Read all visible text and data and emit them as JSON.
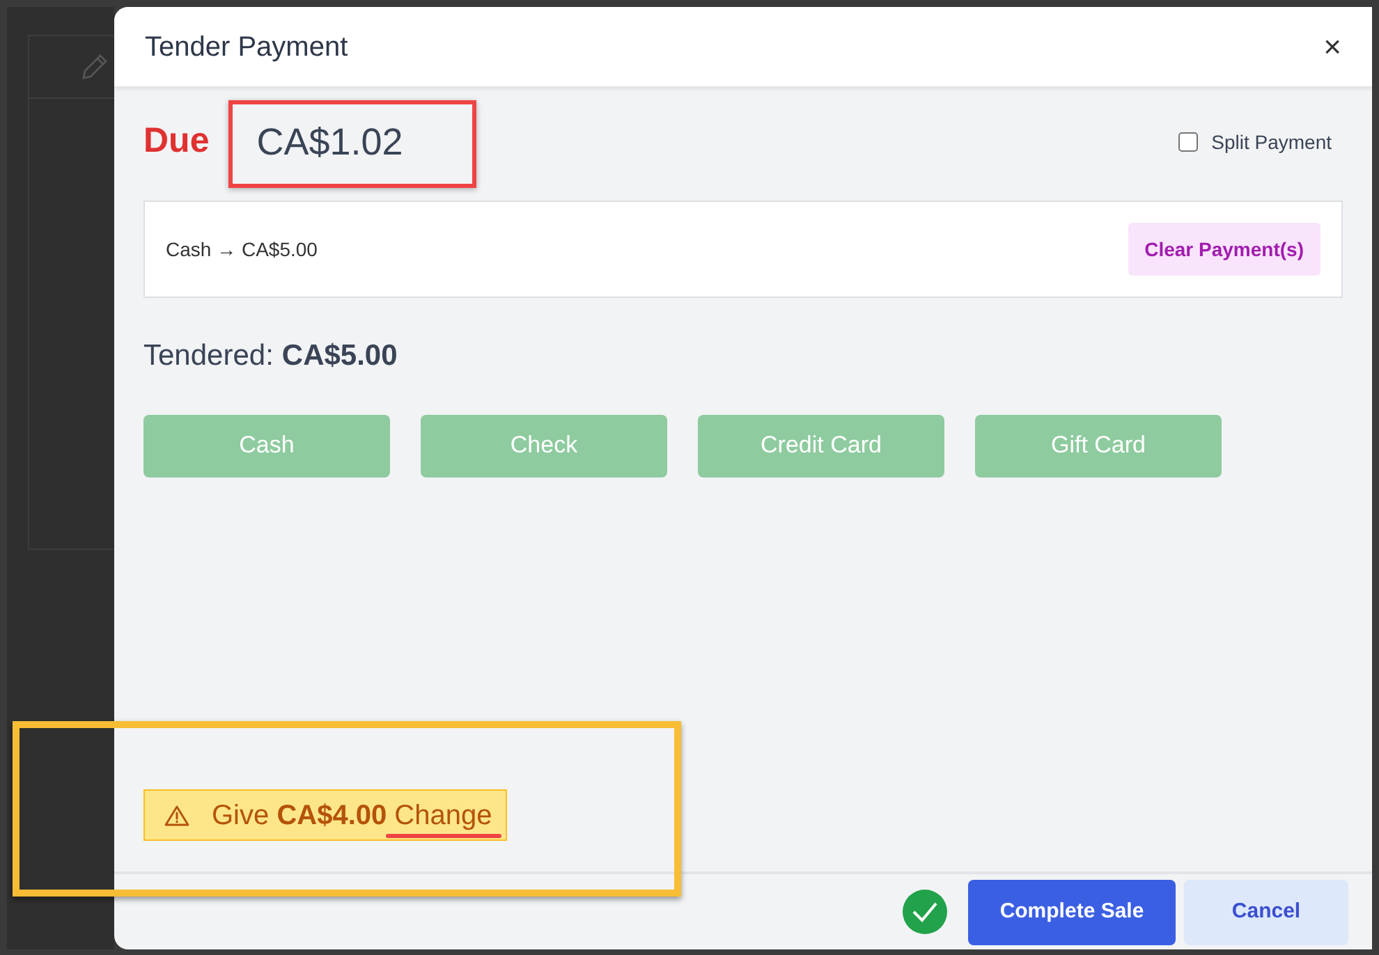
{
  "dialog": {
    "title": "Tender Payment",
    "close": "×"
  },
  "due": {
    "label": "Due",
    "amount": "CA$1.02"
  },
  "split_payment": {
    "label": "Split Payment",
    "checked": false
  },
  "payments": [
    {
      "text": "Cash → CA$5.00"
    }
  ],
  "clear_button": "Clear Payment(s)",
  "tendered": {
    "label": "Tendered:",
    "amount": "CA$5.00"
  },
  "methods": [
    "Cash",
    "Check",
    "Credit Card",
    "Gift Card"
  ],
  "change_alert": "Give **CA$4.00** Change",
  "footer": {
    "buttons": [
      {
        "label": "Complete Sale",
        "kind": "primary"
      },
      {
        "label": "Cancel",
        "kind": "secondary"
      }
    ]
  }
}
